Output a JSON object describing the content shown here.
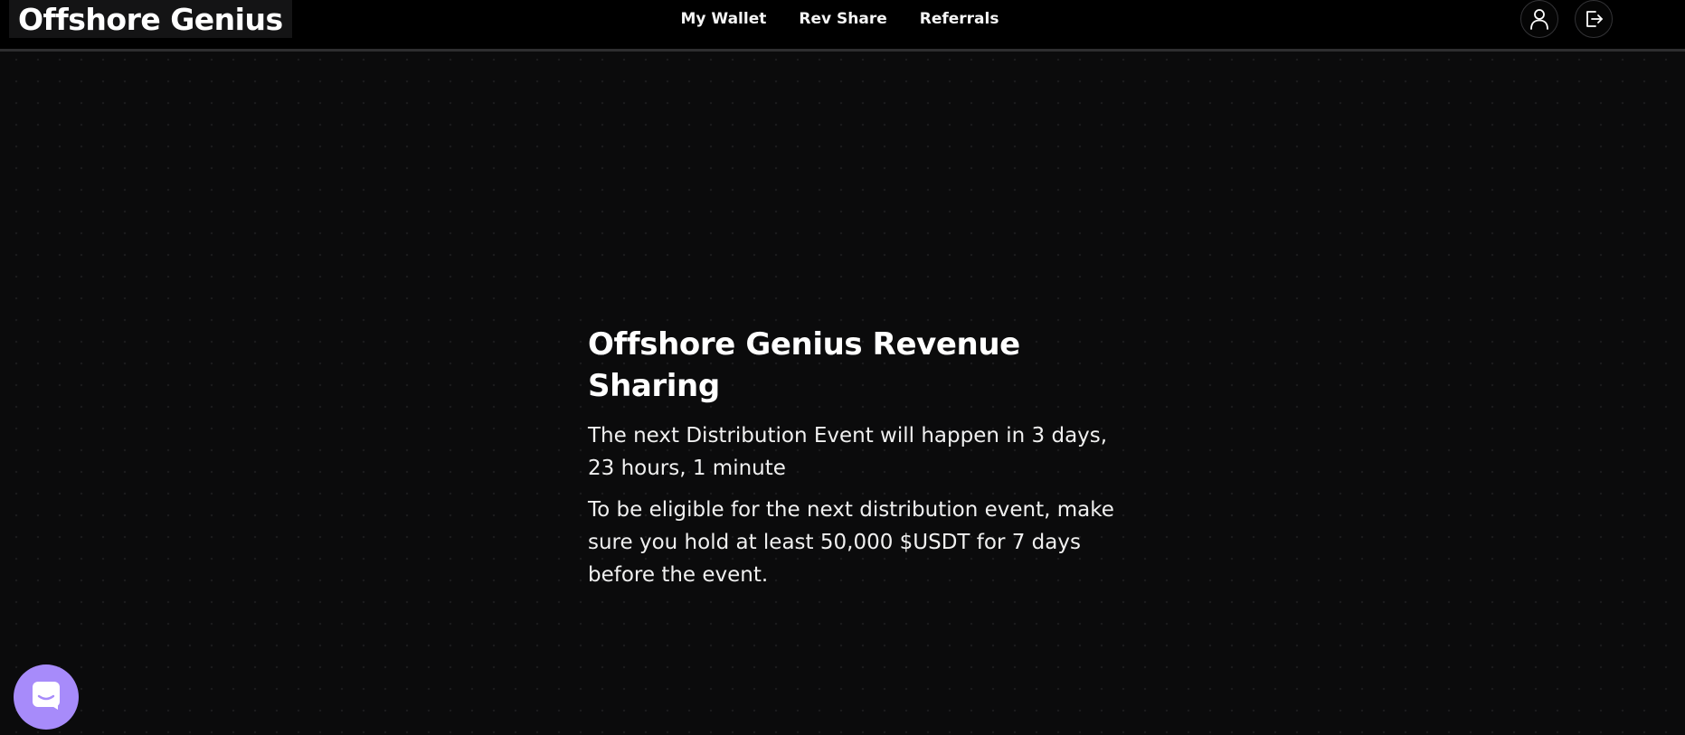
{
  "header": {
    "brand": "Offshore Genius",
    "nav": [
      {
        "label": "My Wallet"
      },
      {
        "label": "Rev Share"
      },
      {
        "label": "Referrals"
      }
    ],
    "icons": {
      "profile": "user-icon",
      "logout": "logout-icon"
    }
  },
  "main": {
    "title": "Offshore Genius Revenue Sharing",
    "countdown_text": "The next Distribution Event will happen in 3 days, 23 hours, 1 minute",
    "eligibility_text": "To be eligible for the next distribution event, make sure you hold at least 50,000 $USDT for 7 days before the event."
  },
  "chat_launcher": {
    "icon": "chat-icon",
    "color": "#a78bfa"
  },
  "colors": {
    "background": "#0b0b0c",
    "topbar": "#000000",
    "accent": "#a78bfa"
  }
}
